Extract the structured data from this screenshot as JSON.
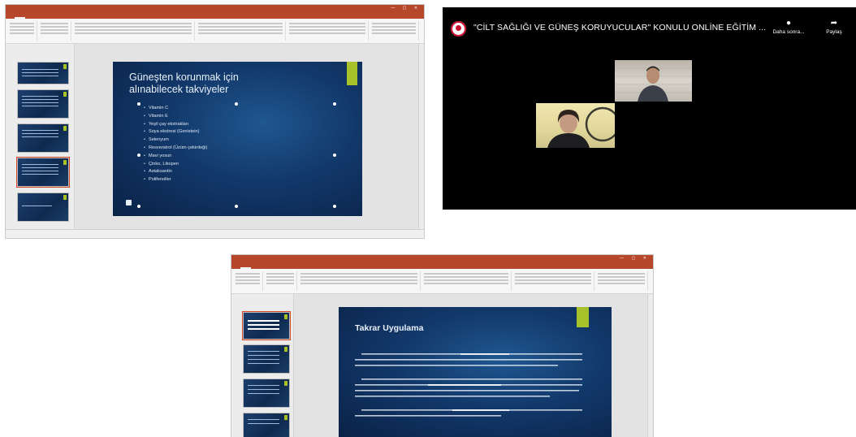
{
  "ppt_window_1": {
    "slide": {
      "title_line1": "Güneşten korunmak için",
      "title_line2": "alınabilecek takviyeler",
      "bullets": [
        "Vitamin C",
        "Vitamin E",
        "Yeşil çay ekstrakları",
        "Soya ekstresi (Genistein)",
        "Selenyum",
        "Resveratrol (Üzüm çekirdeği)",
        "Mavi yosun",
        "Çinko, Likopen",
        "Astaksantin",
        "Polifenoller"
      ]
    }
  },
  "video_window": {
    "meeting_title": "\"CİLT SAĞLIĞI VE GÜNEŞ KORUYUCULAR\" KONULU ONLİNE EĞİTİM ...",
    "later_label": "Daha sonra...",
    "share_label": "Paylaş",
    "later_icon": "clock-icon",
    "share_icon": "share-arrow-icon",
    "logo_icon": "organization-logo-icon"
  },
  "ppt_window_2": {
    "slide": {
      "title": "Takrar Uygulama"
    }
  },
  "colors": {
    "ppt_accent": "#b7472a",
    "slide_background": "#12386a",
    "slide_accent": "#a7c12b",
    "video_background": "#000000"
  }
}
